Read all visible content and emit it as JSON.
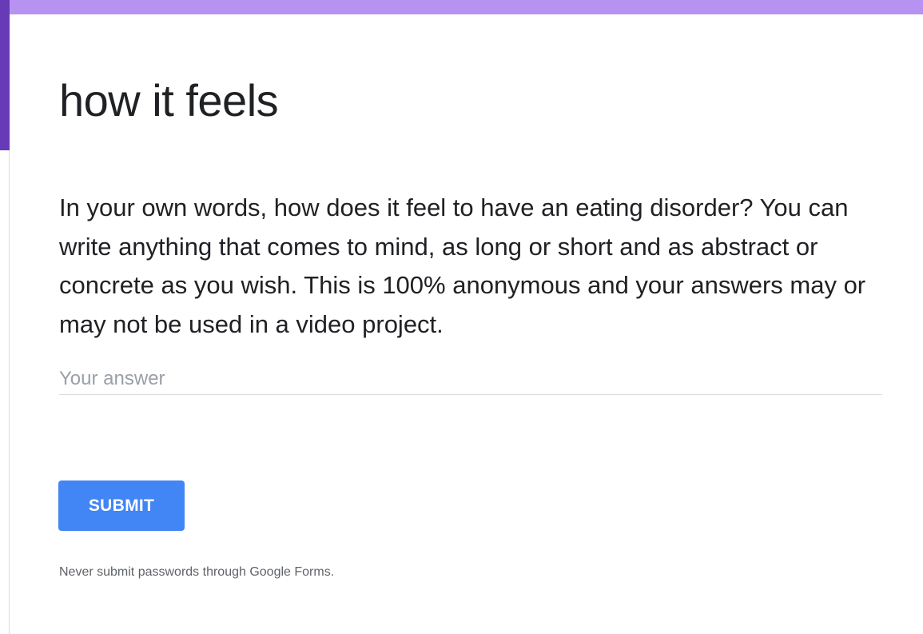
{
  "form": {
    "title": "how it feels",
    "question": "In your own words, how does it feel to have an eating disorder? You can write anything that comes to mind, as long or short and as abstract or concrete as you wish. This is 100% anonymous and your answers may or may not be used in a video project.",
    "answer_placeholder": "Your answer",
    "answer_value": "",
    "submit_label": "SUBMIT",
    "disclaimer": "Never submit passwords through Google Forms."
  },
  "colors": {
    "accent": "#673ab7",
    "header_bar": "#b892f0",
    "button": "#4285f4"
  }
}
